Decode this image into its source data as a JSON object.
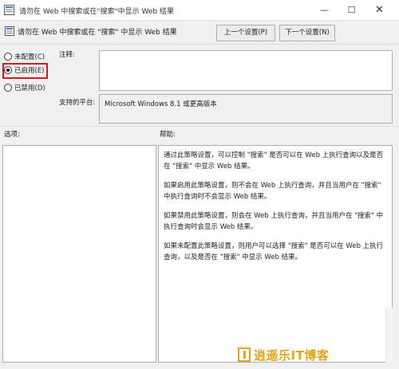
{
  "window": {
    "title": "请勿在 Web 中搜索或在\"搜索\"中显示 Web 结果",
    "minimize_glyph": "—",
    "maximize_glyph": "☐",
    "close_glyph": "✕"
  },
  "header": {
    "policy_name": "请勿在 Web 中搜索或在 \"搜索\" 中显示 Web 结果",
    "prev_setting": "上一个设置(P)",
    "next_setting": "下一个设置(N)"
  },
  "state_options": [
    {
      "label": "未配置(C)",
      "selected": false
    },
    {
      "label": "已启用(E)",
      "selected": true
    },
    {
      "label": "已禁用(D)",
      "selected": false
    }
  ],
  "highlight_color": "#e0141e",
  "comment": {
    "label": "注释:",
    "value": ""
  },
  "platform": {
    "label": "支持的平台:",
    "value": "Microsoft Windows 8.1 或更高版本"
  },
  "options": {
    "label": "选项:"
  },
  "help": {
    "label": "帮助:",
    "paragraphs": [
      "通过此策略设置，可以控制 \"搜索\" 是否可以在 Web 上执行查询以及是否在 \"搜索\" 中显示 Web 结果。",
      "如果启用此策略设置，则不会在 Web 上执行查询，并且当用户在 \"搜索\" 中执行查询时不会显示 Web 结果。",
      "如果禁用此策略设置，则会在 Web 上执行查询，并且当用户在 \"搜索\" 中执行查询时会显示 Web 结果。",
      "如果未配置此策略设置，则用户可以选择 \"搜索\" 是否可以在 Web 上执行查询，以及是否在 \"搜索\" 中显示 Web 结果。"
    ]
  },
  "watermark": {
    "text": "逍遥乐IT博客",
    "color": "#e8a21a"
  }
}
